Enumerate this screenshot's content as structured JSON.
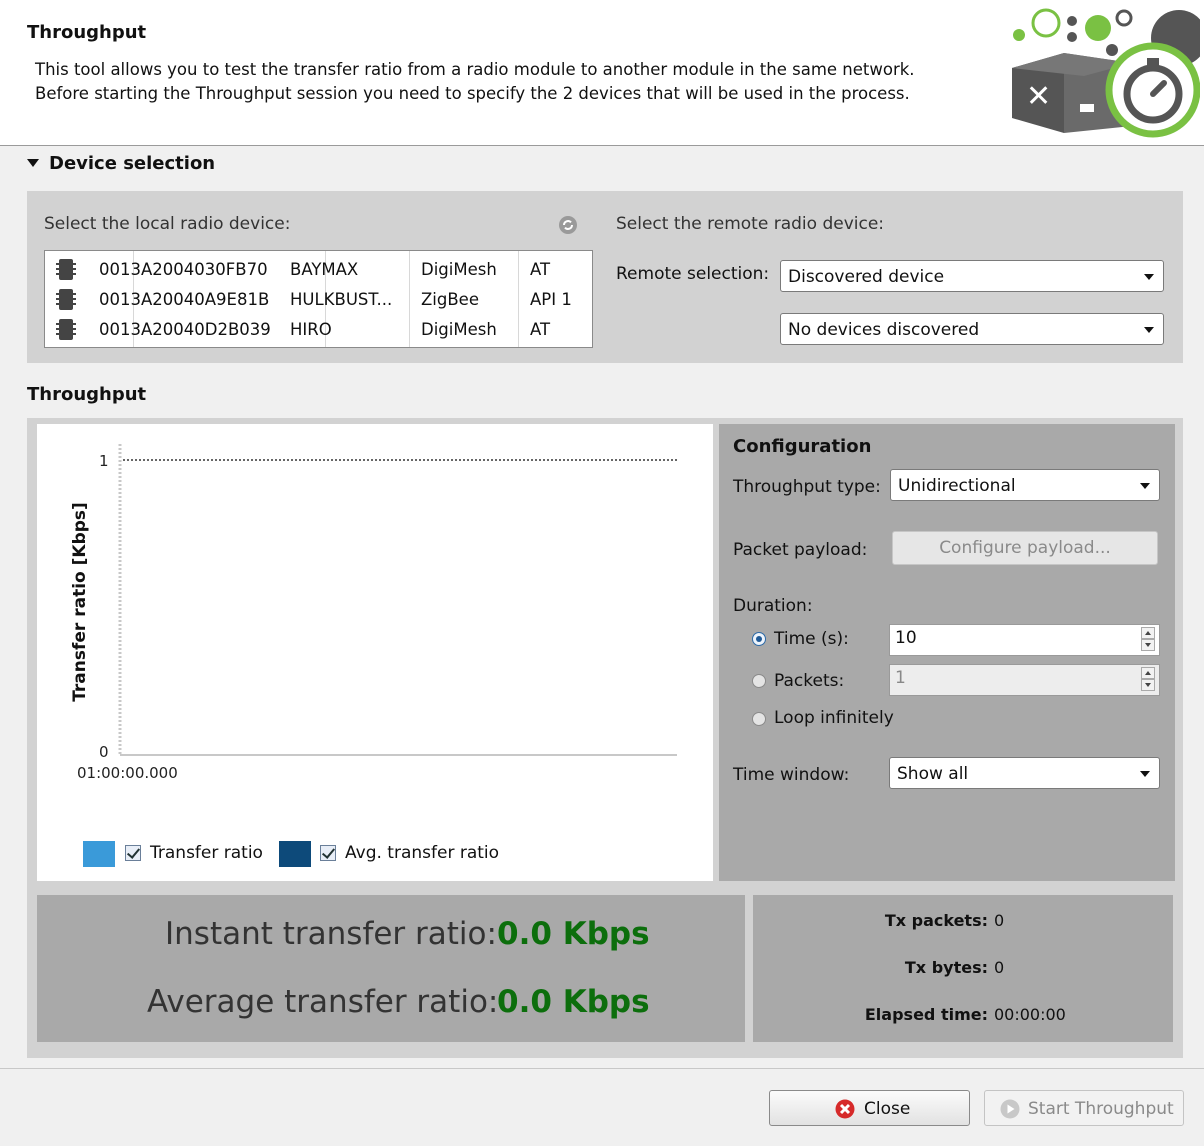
{
  "header": {
    "title": "Throughput",
    "description_line1": "This tool allows you to test the transfer ratio from a radio module to another module in the same network.",
    "description_line2": "Before starting the Throughput session you need to specify the 2 devices that will be used in the process."
  },
  "device_selection": {
    "heading": "Device selection",
    "local_label": "Select the local radio device:",
    "remote_label": "Select the remote radio device:",
    "remote_selection_label": "Remote selection:",
    "remote_selection_value": "Discovered device",
    "remote_device_value": "No devices discovered",
    "devices": [
      {
        "address": "0013A2004030FB70",
        "name": "BAYMAX",
        "protocol": "DigiMesh",
        "mode": "AT"
      },
      {
        "address": "0013A20040A9E81B",
        "name": "HULKBUST...",
        "protocol": "ZigBee",
        "mode": "API 1"
      },
      {
        "address": "0013A20040D2B039",
        "name": "HIRO",
        "protocol": "DigiMesh",
        "mode": "AT"
      }
    ]
  },
  "throughput": {
    "heading": "Throughput",
    "chart_data": {
      "type": "line",
      "title": "",
      "xlabel": "",
      "ylabel": "Transfer ratio [Kbps]",
      "x_tick_labels": [
        "01:00:00.000"
      ],
      "y_tick_labels": [
        "0",
        "1"
      ],
      "ylim": [
        0,
        1
      ],
      "grid": false,
      "series": [
        {
          "name": "Transfer ratio",
          "color": "#3a9ad9",
          "values": []
        },
        {
          "name": "Avg. transfer ratio",
          "color": "#0d4a7a",
          "values": []
        }
      ],
      "legend_position": "bottom-left"
    },
    "legend": {
      "transfer_ratio": "Transfer ratio",
      "avg_transfer_ratio": "Avg. transfer ratio"
    },
    "configuration": {
      "title": "Configuration",
      "throughput_type_label": "Throughput type:",
      "throughput_type_value": "Unidirectional",
      "packet_payload_label": "Packet payload:",
      "configure_payload_button": "Configure payload...",
      "duration_label": "Duration:",
      "time_label": "Time (s):",
      "time_value": "10",
      "packets_label": "Packets:",
      "packets_value": "1",
      "loop_label": "Loop infinitely",
      "time_window_label": "Time window:",
      "time_window_value": "Show all"
    },
    "stats": {
      "instant_label": "Instant transfer ratio:",
      "instant_value": "0.0 Kbps",
      "average_label": "Average transfer ratio:",
      "average_value": "0.0 Kbps",
      "tx_packets_label": "Tx packets:",
      "tx_packets_value": "0",
      "tx_bytes_label": "Tx bytes:",
      "tx_bytes_value": "0",
      "elapsed_label": "Elapsed time:",
      "elapsed_value": "00:00:00"
    }
  },
  "footer": {
    "close_button": "Close",
    "start_button": "Start Throughput"
  },
  "colors": {
    "accent_green": "#7ac143",
    "value_green": "#0c6e0c",
    "panel_gray": "#d2d2d2",
    "dark_panel_gray": "#a9a9a9"
  }
}
